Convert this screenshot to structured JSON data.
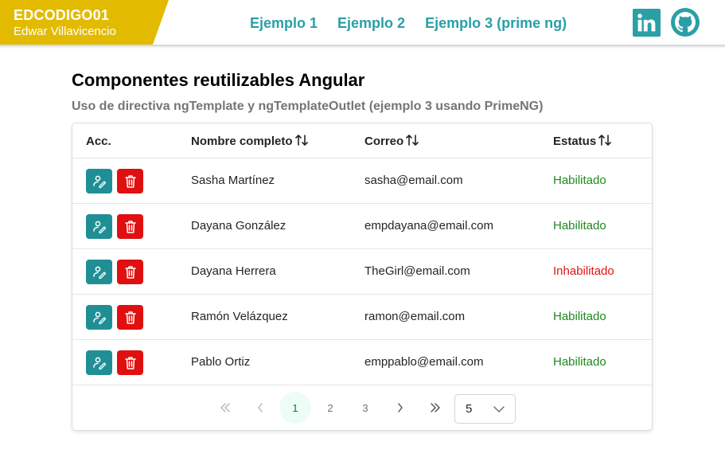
{
  "header": {
    "brand_title": "EDCODIGO01",
    "brand_subtitle": "Edwar Villavicencio",
    "nav": [
      "Ejemplo 1",
      "Ejemplo 2",
      "Ejemplo 3 (prime ng)"
    ],
    "linkedin_icon": "linkedin-icon",
    "github_icon": "github-icon"
  },
  "page": {
    "title": "Componentes reutilizables Angular",
    "subtitle": "Uso de directiva ngTemplate y ngTemplateOutlet (ejemplo 3 usando PrimeNG)"
  },
  "table": {
    "headers": {
      "actions": "Acc.",
      "name": "Nombre completo",
      "email": "Correo",
      "status": "Estatus"
    },
    "rows": [
      {
        "name": "Sasha Martínez",
        "email": "sasha@email.com",
        "status": "Habilitado",
        "enabled": true
      },
      {
        "name": "Dayana González",
        "email": "empdayana@email.com",
        "status": "Habilitado",
        "enabled": true
      },
      {
        "name": "Dayana Herrera",
        "email": "TheGirl@email.com",
        "status": "Inhabilitado",
        "enabled": false
      },
      {
        "name": "Ramón Velázquez",
        "email": "ramon@email.com",
        "status": "Habilitado",
        "enabled": true
      },
      {
        "name": "Pablo Ortiz",
        "email": "emppablo@email.com",
        "status": "Habilitado",
        "enabled": true
      }
    ]
  },
  "paginator": {
    "first": "«",
    "prev": "‹",
    "pages": [
      "1",
      "2",
      "3"
    ],
    "current_page": "1",
    "next": "›",
    "last": "»",
    "rows_per_page": "5"
  },
  "colors": {
    "brand": "#e2bb00",
    "accent": "#2a9fa6",
    "edit_button": "#1f8f95",
    "delete_button": "#e01010",
    "enabled": "#1e8a1e",
    "disabled": "#e01414"
  }
}
